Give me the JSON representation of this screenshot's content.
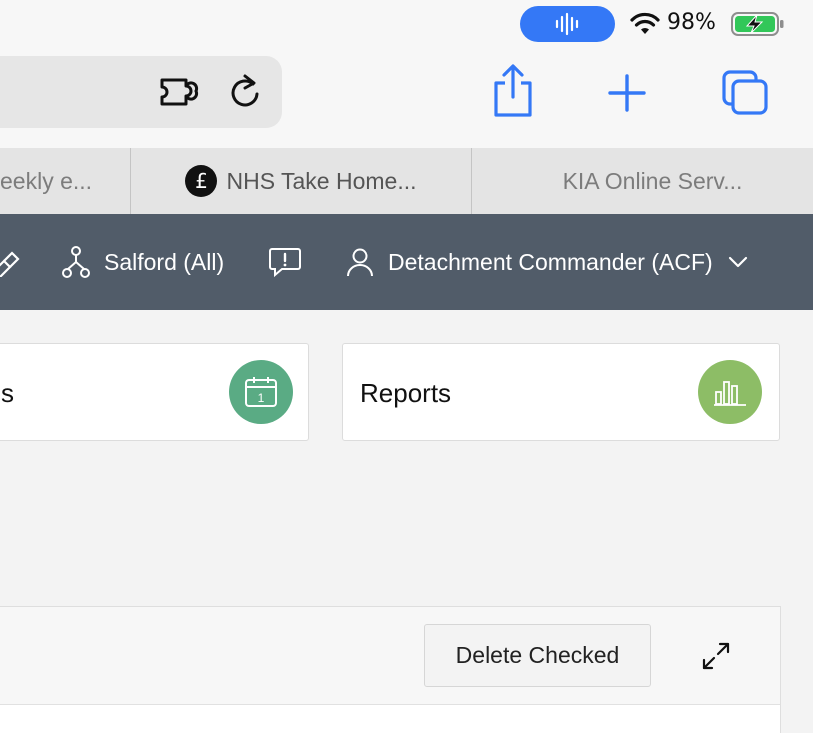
{
  "status_bar": {
    "battery_percent": "98%",
    "battery_color": "#32c759",
    "mic_pill_color": "#3478f6"
  },
  "toolbar": {
    "icons": [
      "extension-icon",
      "reload-icon",
      "share-icon",
      "new-tab-plus-icon",
      "tabs-overview-icon"
    ],
    "accent_color": "#3478f6"
  },
  "tabs": [
    {
      "label": "eekly e..."
    },
    {
      "label": "NHS Take Home...",
      "favicon": "£"
    },
    {
      "label": "KIA Online Serv..."
    }
  ],
  "nav": {
    "location_label": "Salford (All)",
    "user_label": "Detachment Commander (ACF)",
    "bar_color": "#515c69"
  },
  "cards": [
    {
      "label": "s",
      "icon": "calendar-icon",
      "icon_text": "1",
      "color": "#5aab84"
    },
    {
      "label": "Reports",
      "icon": "bar-chart-icon",
      "color": "#8dbd66"
    }
  ],
  "panel": {
    "delete_label": "Delete Checked"
  }
}
